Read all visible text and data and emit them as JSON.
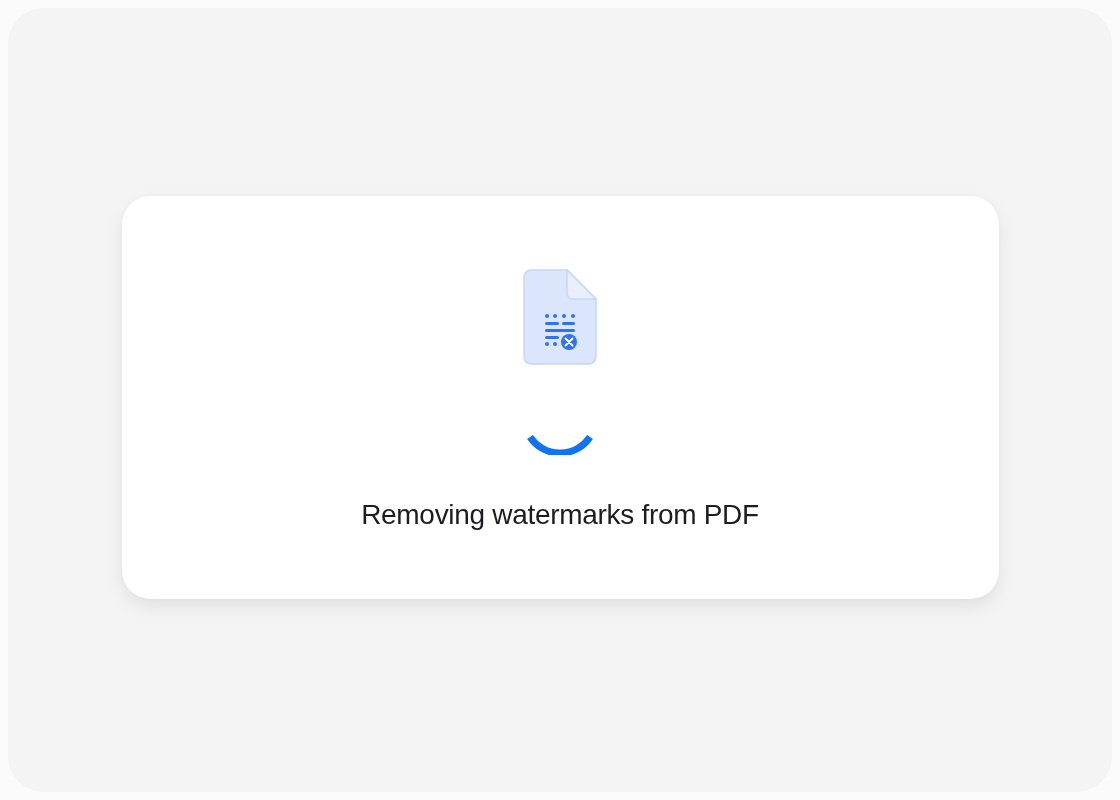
{
  "dialog": {
    "message": "Removing watermarks from PDF"
  }
}
